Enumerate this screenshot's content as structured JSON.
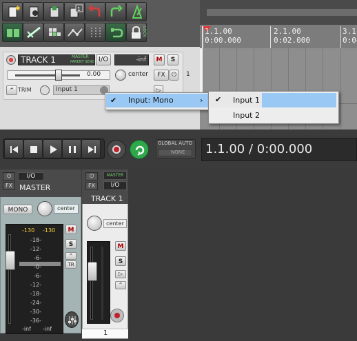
{
  "toolbar": {
    "icons": [
      "new-project-icon",
      "open-project-icon",
      "save-project-icon",
      "project-tab-icon",
      "undo-icon",
      "redo-icon",
      "metronome-icon",
      "snap-icon",
      "ripple-edit-icon",
      "grid-icon",
      "routing-icon",
      "loop-icon",
      "envelope-lock-icon",
      "loop-repeat-icon",
      "lock-icon"
    ],
    "lock_label": "LOCK",
    "tab_count": "1"
  },
  "ruler": {
    "marks": [
      {
        "bar": "1.1.00",
        "time": "0:00.000"
      },
      {
        "bar": "2.1.00",
        "time": "0:02.000"
      },
      {
        "bar": "3.1",
        "time": "0:04"
      }
    ]
  },
  "track": {
    "name": "TRACK 1",
    "number": "1",
    "master_send": "MASTER",
    "parent_send": "PARENT SEND",
    "io_label": "I/O",
    "meter_value": "-inf",
    "mute": "M",
    "solo": "S",
    "volume": "0.00",
    "pan": "center",
    "fx": "FX",
    "trim": "TRIM",
    "input": "Input 1"
  },
  "menu": {
    "item": "Input: Mono",
    "submenu": [
      "Input 1",
      "Input 2"
    ]
  },
  "transport": {
    "global_auto": "GLOBAL AUTO",
    "global_auto_value": "NONE",
    "time": "1.1.00 / 0:00.000"
  },
  "mixer": {
    "master": {
      "io": "I/O",
      "fx": "FX",
      "name": "MASTER",
      "mono": "MONO",
      "pan": "center",
      "peak_left": "-130",
      "peak_right": "-130",
      "scale": [
        "-18-",
        "-12-",
        "-6-",
        "-0-",
        "-6-",
        "-12-",
        "-18-",
        "-24-",
        "-30-",
        "-36-"
      ],
      "bottom_left": "-inf",
      "bottom_right": "-inf",
      "mute": "M",
      "solo": "S",
      "tr": "TR"
    },
    "track": {
      "fx": "FX",
      "master": "MASTER",
      "io": "I/O",
      "name": "TRACK 1",
      "pan": "center",
      "mute": "M",
      "solo": "S",
      "number": "1"
    }
  },
  "colors": {
    "menu_highlight": "#99c8f5",
    "record": "#c0202a",
    "play_green": "#2ea84a",
    "mixer_master_bg": "#a4b3b3"
  }
}
